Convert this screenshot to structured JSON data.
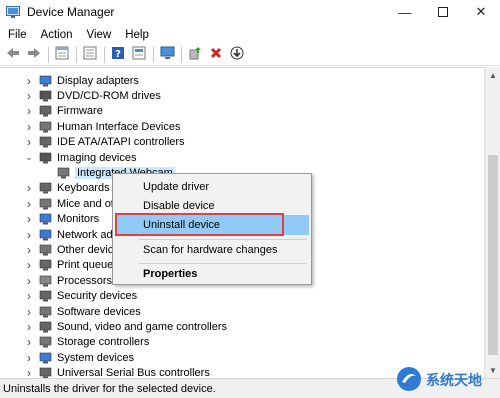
{
  "window": {
    "title": "Device Manager",
    "controls": [
      "minimize-icon",
      "maximize-icon",
      "close-icon"
    ]
  },
  "menubar": {
    "items": [
      "File",
      "Action",
      "View",
      "Help"
    ]
  },
  "toolbar": {
    "buttons": [
      "back-icon",
      "forward-icon",
      "properties-icon",
      "show-hide-icon",
      "help-icon",
      "details-icon",
      "computer-icon",
      "update-driver-icon",
      "uninstall-x-icon",
      "download-icon"
    ]
  },
  "tree": {
    "items": [
      {
        "label": "Display adapters",
        "icon": "display-adapter-icon",
        "expanded": false
      },
      {
        "label": "DVD/CD-ROM drives",
        "icon": "dvd-icon",
        "expanded": false
      },
      {
        "label": "Firmware",
        "icon": "firmware-icon",
        "expanded": false
      },
      {
        "label": "Human Interface Devices",
        "icon": "hid-icon",
        "expanded": false
      },
      {
        "label": "IDE ATA/ATAPI controllers",
        "icon": "ide-icon",
        "expanded": false
      },
      {
        "label": "Imaging devices",
        "icon": "camera-icon",
        "expanded": true
      },
      {
        "label": "Integrated Webcam",
        "icon": "webcam-icon",
        "child": true,
        "selected": true
      },
      {
        "label": "Keyboards",
        "icon": "keyboard-icon",
        "expanded": false
      },
      {
        "label": "Mice and oth",
        "icon": "mouse-icon",
        "expanded": false
      },
      {
        "label": "Monitors",
        "icon": "monitor-icon",
        "expanded": false
      },
      {
        "label": "Network ada",
        "icon": "network-icon",
        "expanded": false
      },
      {
        "label": "Other device",
        "icon": "other-device-icon",
        "expanded": false
      },
      {
        "label": "Print queues",
        "icon": "printer-icon",
        "expanded": false
      },
      {
        "label": "Processors",
        "icon": "processor-icon",
        "expanded": false
      },
      {
        "label": "Security devices",
        "icon": "security-icon",
        "expanded": false
      },
      {
        "label": "Software devices",
        "icon": "software-icon",
        "expanded": false
      },
      {
        "label": "Sound, video and game controllers",
        "icon": "sound-icon",
        "expanded": false
      },
      {
        "label": "Storage controllers",
        "icon": "storage-icon",
        "expanded": false
      },
      {
        "label": "System devices",
        "icon": "system-icon",
        "expanded": false
      },
      {
        "label": "Universal Serial Bus controllers",
        "icon": "usb-icon",
        "expanded": false
      }
    ]
  },
  "context_menu": {
    "items": [
      {
        "label": "Update driver"
      },
      {
        "label": "Disable device"
      },
      {
        "label": "Uninstall device",
        "highlighted": true
      },
      {
        "label": "Scan for hardware changes"
      },
      {
        "label": "Properties",
        "bold": true
      }
    ]
  },
  "statusbar": {
    "text": "Uninstalls the driver for the selected device."
  },
  "watermark": {
    "text": "系统天地"
  },
  "colors": {
    "highlight": "#91c9f7",
    "annotation_box": "#e53e3e"
  }
}
